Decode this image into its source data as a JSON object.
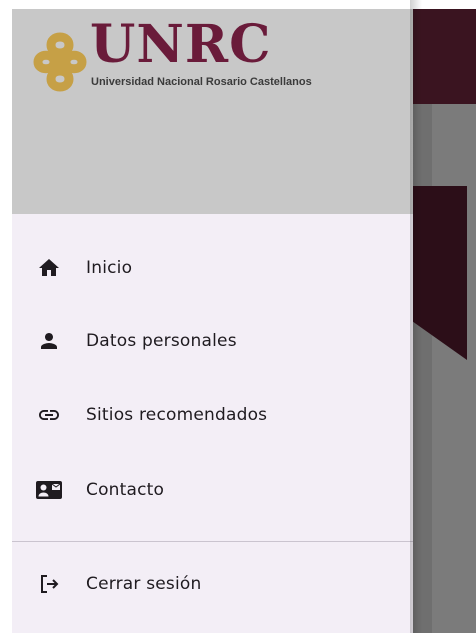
{
  "header": {
    "logo_wordmark": "UNRC",
    "logo_subtitle": "Universidad Nacional Rosario Castellanos",
    "brand_color": "#6a1b3a",
    "logo_mark_color": "#c6a046"
  },
  "menu": {
    "items": [
      {
        "label": "Inicio",
        "icon": "home-icon"
      },
      {
        "label": "Datos personales",
        "icon": "person-icon"
      },
      {
        "label": "Sitios recomendados",
        "icon": "link-icon"
      },
      {
        "label": "Contacto",
        "icon": "contact-card-icon"
      }
    ],
    "logout": {
      "label": "Cerrar sesión",
      "icon": "logout-icon"
    }
  },
  "colors": {
    "drawer_background": "#f3eef6",
    "header_background": "#c8c8c8",
    "app_bar_background": "#3a1420"
  }
}
